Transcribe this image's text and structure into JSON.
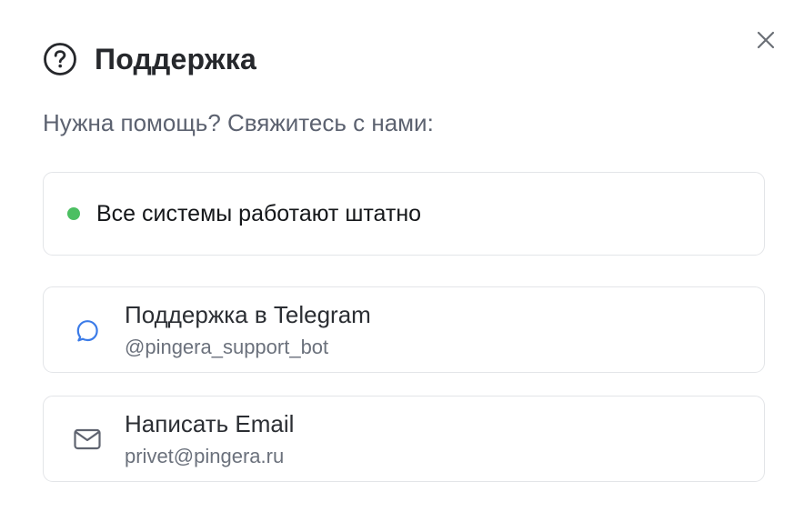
{
  "dialog": {
    "title": "Поддержка",
    "subtitle": "Нужна помощь? Свяжитесь с нами:",
    "icon": "help-circle-icon",
    "close_icon": "close-icon"
  },
  "status": {
    "text": "Все системы работают штатно",
    "dot_color": "#4cbf62"
  },
  "contacts": [
    {
      "icon": "message-circle-icon",
      "icon_color": "#3b7be8",
      "title": "Поддержка в Telegram",
      "subtitle": "@pingera_support_bot"
    },
    {
      "icon": "mail-icon",
      "icon_color": "#5f6470",
      "title": "Написать Email",
      "subtitle": "privet@pingera.ru"
    }
  ]
}
